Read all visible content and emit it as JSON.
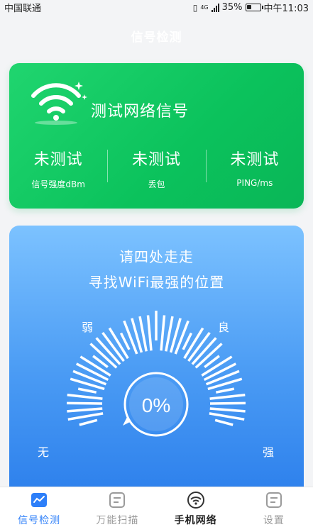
{
  "status_bar": {
    "carrier": "中国联通",
    "network": "4G",
    "battery": "35%",
    "battery_level": 0.35,
    "time": "中午11:03"
  },
  "header": {
    "title": "信号检测"
  },
  "signal_card": {
    "title": "测试网络信号",
    "metrics": [
      {
        "value": "未测试",
        "label": "信号强度dBm"
      },
      {
        "value": "未测试",
        "label": "丢包"
      },
      {
        "value": "未测试",
        "label": "PING/ms"
      }
    ]
  },
  "gauge_card": {
    "hint_line1": "请四处走走",
    "hint_line2": "寻找WiFi最强的位置",
    "labels": {
      "none": "无",
      "weak": "弱",
      "good": "良",
      "strong": "强"
    },
    "percent": "0%",
    "level": 0
  },
  "tabbar": {
    "tabs": [
      {
        "label": "信号检测",
        "icon": "chart-icon",
        "state": "active"
      },
      {
        "label": "万能扫描",
        "icon": "scan-icon",
        "state": "inactive"
      },
      {
        "label": "手机网络",
        "icon": "wifi-icon",
        "state": "bold"
      },
      {
        "label": "设置",
        "icon": "settings-icon",
        "state": "inactive"
      }
    ]
  },
  "colors": {
    "green_card": "#0bc25c",
    "blue_card": "#4a9bf4",
    "tab_active": "#2d7ff9",
    "tab_inactive": "#9a9a9a",
    "tab_bold": "#222222"
  }
}
